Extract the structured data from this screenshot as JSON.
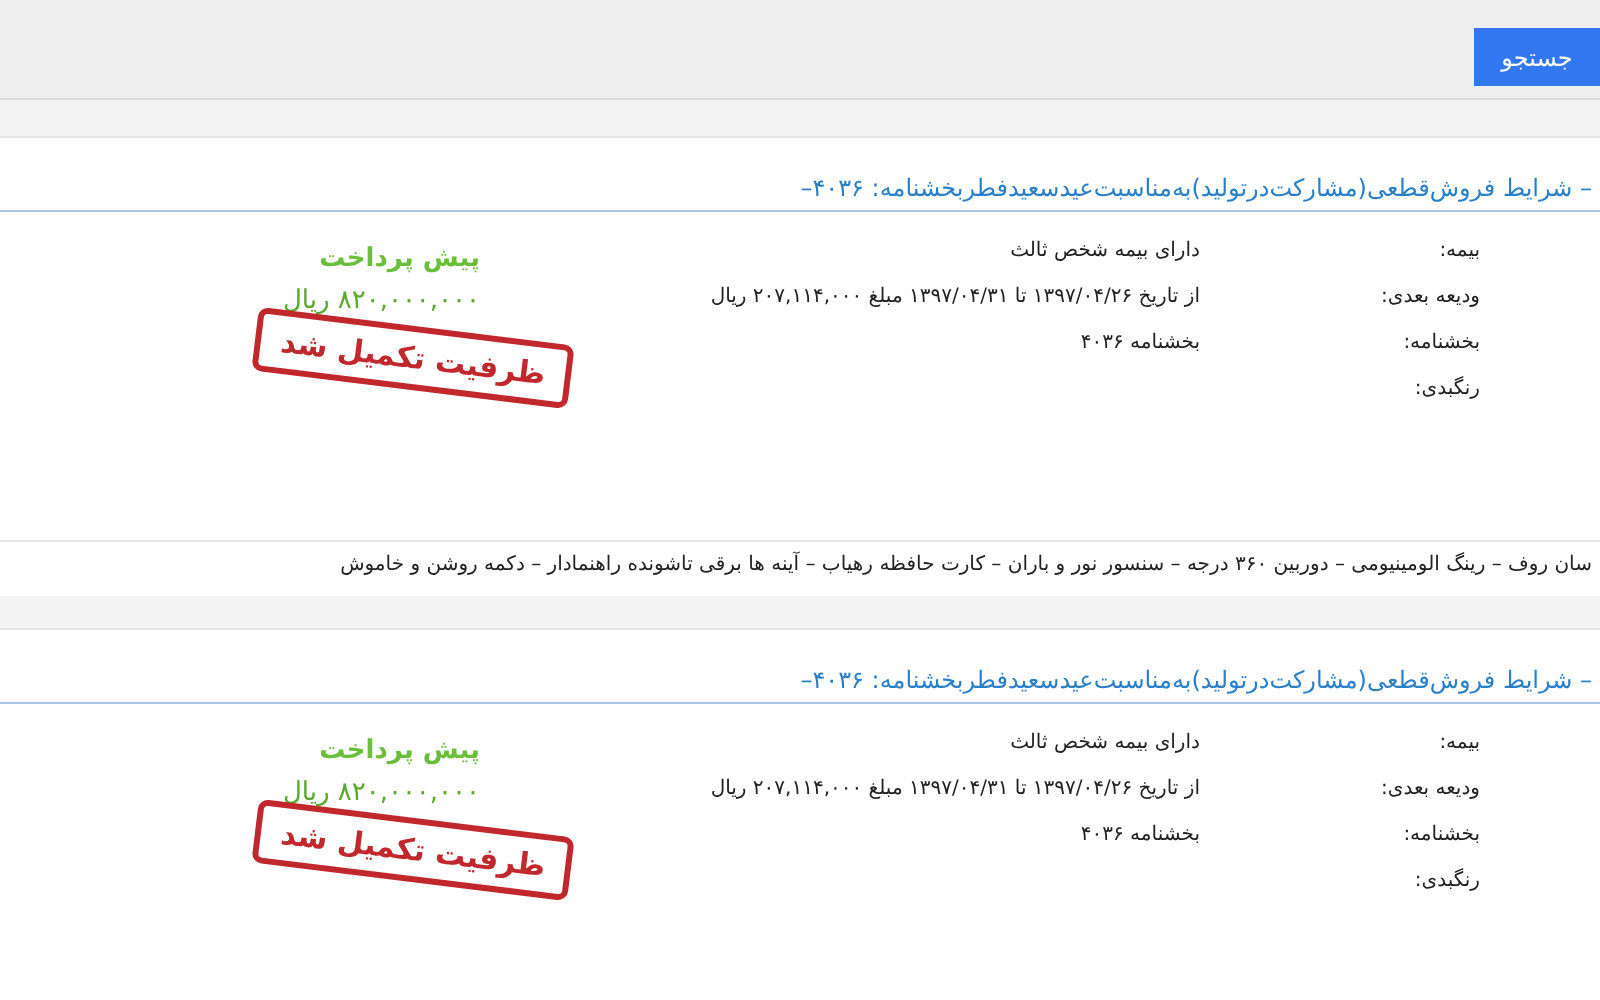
{
  "search_button": "جستجو",
  "listings": [
    {
      "title": "– شرایط فروش‌قطعی(مشارکت‌درتولید)به‌مناسبت‌عیدسعیدفطربخشنامه: ۴۰۳۶–",
      "fields": [
        {
          "label": "بیمه:",
          "value": "دارای بیمه شخص ثالث"
        },
        {
          "label": "ودیعه بعدی:",
          "value": "از تاریخ ۱۳۹۷/۰۴/۲۶ تا ۱۳۹۷/۰۴/۳۱ مبلغ ۲۰۷,۱۱۴,۰۰۰ ریال"
        },
        {
          "label": "بخشنامه:",
          "value": "بخشنامه ۴۰۳۶"
        },
        {
          "label": "رنگبدی:"
        }
      ],
      "prepayment_label": "پیش پرداخت",
      "price": "۸۲۰,۰۰۰,۰۰۰ ریال",
      "stamp": "ظرفیت تکمیل شد",
      "features": "سان روف – رینگ الومینیومی – دوربین ۳۶۰ درجه – سنسور نور و باران – کارت حافظه رهیاب – آینه ها برقی تاشونده راهنمادار – دکمه روشن و خاموش"
    },
    {
      "title": "– شرایط فروش‌قطعی(مشارکت‌درتولید)به‌مناسبت‌عیدسعیدفطربخشنامه: ۴۰۳۶–",
      "fields": [
        {
          "label": "بیمه:",
          "value": "دارای بیمه شخص ثالث"
        },
        {
          "label": "ودیعه بعدی:",
          "value": "از تاریخ ۱۳۹۷/۰۴/۲۶ تا ۱۳۹۷/۰۴/۳۱ مبلغ ۲۰۷,۱۱۴,۰۰۰ ریال"
        },
        {
          "label": "بخشنامه:",
          "value": "بخشنامه ۴۰۳۶"
        },
        {
          "label": "رنگبدی:"
        }
      ],
      "prepayment_label": "پیش پرداخت",
      "price": "۸۲۰,۰۰۰,۰۰۰ ریال",
      "stamp": "ظرفیت تکمیل شد"
    }
  ]
}
